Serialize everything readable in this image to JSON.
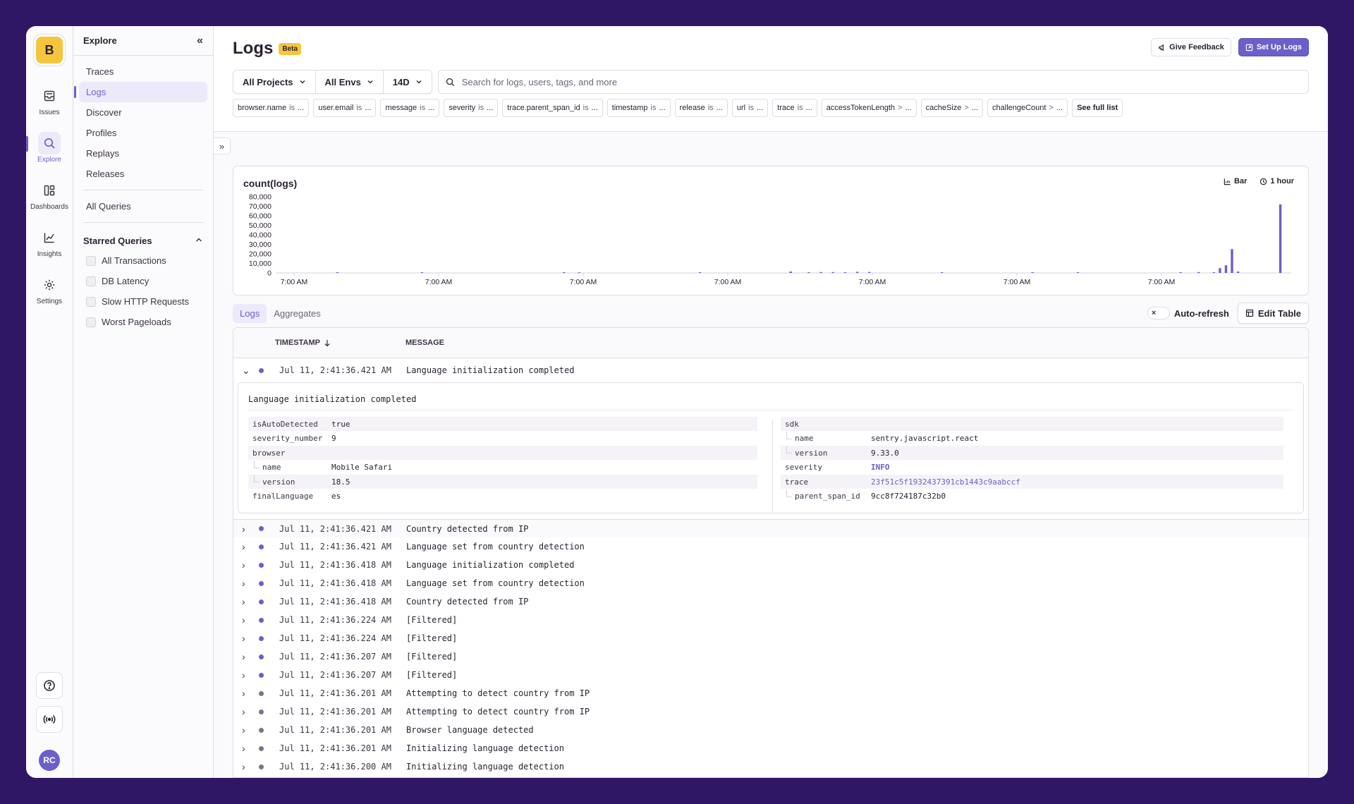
{
  "rail": {
    "org_initial": "B",
    "items": [
      {
        "label": "Issues",
        "icon": "inbox-icon"
      },
      {
        "label": "Explore",
        "icon": "search-icon"
      },
      {
        "label": "Dashboards",
        "icon": "dashboard-icon"
      },
      {
        "label": "Insights",
        "icon": "graph-icon"
      },
      {
        "label": "Settings",
        "icon": "gear-icon"
      }
    ],
    "avatar": "RC"
  },
  "subnav": {
    "title": "Explore",
    "items": [
      "Traces",
      "Logs",
      "Discover",
      "Profiles",
      "Replays",
      "Releases"
    ],
    "all_queries": "All Queries",
    "starred_title": "Starred Queries",
    "starred": [
      "All Transactions",
      "DB Latency",
      "Slow HTTP Requests",
      "Worst Pageloads"
    ]
  },
  "header": {
    "title": "Logs",
    "badge": "Beta",
    "feedback": "Give Feedback",
    "setup": "Set Up Logs"
  },
  "filters": {
    "projects": "All Projects",
    "envs": "All Envs",
    "period": "14D",
    "search_placeholder": "Search for logs, users, tags, and more"
  },
  "chips": [
    {
      "key": "browser.name",
      "op": "is",
      "val": "..."
    },
    {
      "key": "user.email",
      "op": "is",
      "val": "..."
    },
    {
      "key": "message",
      "op": "is",
      "val": "..."
    },
    {
      "key": "severity",
      "op": "is",
      "val": "..."
    },
    {
      "key": "trace.parent_span_id",
      "op": "is",
      "val": "..."
    },
    {
      "key": "timestamp",
      "op": "is",
      "val": "..."
    },
    {
      "key": "release",
      "op": "is",
      "val": "..."
    },
    {
      "key": "url",
      "op": "is",
      "val": "..."
    },
    {
      "key": "trace",
      "op": "is",
      "val": "..."
    },
    {
      "key": "accessTokenLength",
      "op": ">",
      "val": "..."
    },
    {
      "key": "cacheSize",
      "op": ">",
      "val": "..."
    },
    {
      "key": "challengeCount",
      "op": ">",
      "val": "..."
    }
  ],
  "chips_full": "See full list",
  "chart": {
    "title": "count(logs)",
    "type_label": "Bar",
    "interval_label": "1 hour"
  },
  "chart_data": {
    "type": "bar",
    "title": "count(logs)",
    "ylim": [
      0,
      80000
    ],
    "yticks": [
      "80,000",
      "70,000",
      "60,000",
      "50,000",
      "40,000",
      "30,000",
      "20,000",
      "10,000",
      "0"
    ],
    "xticks": [
      "7:00 AM",
      "7:00 AM",
      "7:00 AM",
      "7:00 AM",
      "7:00 AM",
      "7:00 AM",
      "7:00 AM"
    ],
    "bucket_count": 336,
    "color": "#6c5fc7",
    "series": [
      {
        "values_sparse": [
          [
            20,
            600
          ],
          [
            48,
            500
          ],
          [
            95,
            800
          ],
          [
            100,
            500
          ],
          [
            140,
            600
          ],
          [
            170,
            1500
          ],
          [
            176,
            700
          ],
          [
            180,
            900
          ],
          [
            184,
            900
          ],
          [
            188,
            700
          ],
          [
            192,
            1200
          ],
          [
            196,
            1000
          ],
          [
            220,
            500
          ],
          [
            250,
            400
          ],
          [
            265,
            300
          ],
          [
            299,
            600
          ],
          [
            305,
            900
          ],
          [
            310,
            400
          ],
          [
            312,
            5000
          ],
          [
            314,
            8000
          ],
          [
            316,
            25000
          ],
          [
            318,
            1500
          ],
          [
            332,
            72000
          ]
        ]
      }
    ]
  },
  "tabs": [
    "Logs",
    "Aggregates"
  ],
  "autorefresh": "Auto-refresh",
  "autorefresh_x": "×",
  "edit_table": "Edit Table",
  "table": {
    "col_timestamp": "TIMESTAMP",
    "col_message": "MESSAGE",
    "expanded": {
      "timestamp": "Jul 11, 2:41:36.421 AM",
      "message": "Language initialization completed",
      "left": [
        {
          "k": "isAutoDetected",
          "v": "true",
          "indent": 0
        },
        {
          "k": "severity_number",
          "v": "9",
          "indent": 0
        },
        {
          "k": "browser",
          "v": "",
          "indent": 0
        },
        {
          "k": "name",
          "v": "Mobile Safari",
          "indent": 1
        },
        {
          "k": "version",
          "v": "18.5",
          "indent": 1
        },
        {
          "k": "finalLanguage",
          "v": "es",
          "indent": 0
        }
      ],
      "right": [
        {
          "k": "sdk",
          "v": "",
          "indent": 0
        },
        {
          "k": "name",
          "v": "sentry.javascript.react",
          "indent": 1
        },
        {
          "k": "version",
          "v": "9.33.0",
          "indent": 1
        },
        {
          "k": "severity",
          "v": "INFO",
          "indent": 0,
          "style": "info"
        },
        {
          "k": "trace",
          "v": "23f51c5f1932437391cb1443c9aabccf",
          "indent": 0,
          "style": "link"
        },
        {
          "k": "parent_span_id",
          "v": "9cc8f724187c32b0",
          "indent": 1
        }
      ]
    },
    "rows": [
      {
        "timestamp": "Jul 11, 2:41:36.421 AM",
        "message": "Country detected from IP",
        "level": "info"
      },
      {
        "timestamp": "Jul 11, 2:41:36.421 AM",
        "message": "Language set from country detection",
        "level": "info"
      },
      {
        "timestamp": "Jul 11, 2:41:36.418 AM",
        "message": "Language initialization completed",
        "level": "info"
      },
      {
        "timestamp": "Jul 11, 2:41:36.418 AM",
        "message": "Language set from country detection",
        "level": "info"
      },
      {
        "timestamp": "Jul 11, 2:41:36.418 AM",
        "message": "Country detected from IP",
        "level": "info"
      },
      {
        "timestamp": "Jul 11, 2:41:36.224 AM",
        "message": "[Filtered]",
        "level": "info"
      },
      {
        "timestamp": "Jul 11, 2:41:36.224 AM",
        "message": "[Filtered]",
        "level": "info"
      },
      {
        "timestamp": "Jul 11, 2:41:36.207 AM",
        "message": "[Filtered]",
        "level": "info"
      },
      {
        "timestamp": "Jul 11, 2:41:36.207 AM",
        "message": "[Filtered]",
        "level": "info"
      },
      {
        "timestamp": "Jul 11, 2:41:36.201 AM",
        "message": "Attempting to detect country from IP",
        "level": "debug"
      },
      {
        "timestamp": "Jul 11, 2:41:36.201 AM",
        "message": "Attempting to detect country from IP",
        "level": "debug"
      },
      {
        "timestamp": "Jul 11, 2:41:36.201 AM",
        "message": "Browser language detected",
        "level": "debug"
      },
      {
        "timestamp": "Jul 11, 2:41:36.201 AM",
        "message": "Initializing language detection",
        "level": "debug"
      },
      {
        "timestamp": "Jul 11, 2:41:36.200 AM",
        "message": "Initializing language detection",
        "level": "debug"
      }
    ]
  }
}
